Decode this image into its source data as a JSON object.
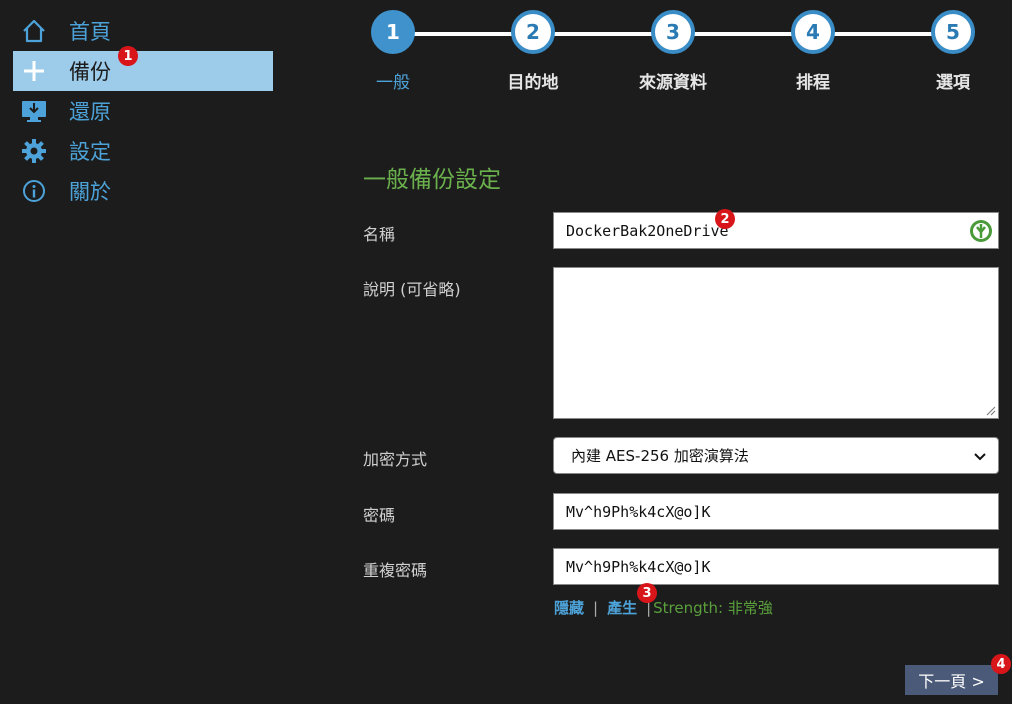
{
  "sidebar": {
    "items": [
      {
        "label": "首頁",
        "icon": "home-icon"
      },
      {
        "label": "備份",
        "icon": "plus-icon",
        "badge": "1",
        "active": true
      },
      {
        "label": "還原",
        "icon": "monitor-download-icon"
      },
      {
        "label": "設定",
        "icon": "gear-icon"
      },
      {
        "label": "關於",
        "icon": "info-icon"
      }
    ]
  },
  "stepper": {
    "steps": [
      {
        "number": "1",
        "label": "一般"
      },
      {
        "number": "2",
        "label": "目的地"
      },
      {
        "number": "3",
        "label": "來源資料"
      },
      {
        "number": "4",
        "label": "排程"
      },
      {
        "number": "5",
        "label": "選項"
      }
    ],
    "current": 1
  },
  "form": {
    "section_title": "一般備份設定",
    "name_label": "名稱",
    "name_value": "DockerBak2OneDrive",
    "name_badge": "2",
    "description_label": "說明 (可省略)",
    "description_value": "",
    "encryption_label": "加密方式",
    "encryption_value": "內建 AES-256 加密演算法",
    "password_label": "密碼",
    "password_value": "Mv^h9Ph%k4cX@o]K",
    "repeat_password_label": "重複密碼",
    "repeat_password_value": "Mv^h9Ph%k4cX@o]K",
    "hide_link": "隱藏",
    "generate_link": "產生",
    "generate_badge": "3",
    "separator": "|",
    "strength_text": "Strength: 非常強"
  },
  "footer": {
    "next_label": "下一頁 >",
    "next_badge": "4"
  },
  "colors": {
    "accent_blue": "#4da3d9",
    "active_nav_bg": "#9dcbea",
    "title_green": "#6ab04c",
    "badge_red": "#d8161a",
    "button_bg": "#4a5a78"
  }
}
